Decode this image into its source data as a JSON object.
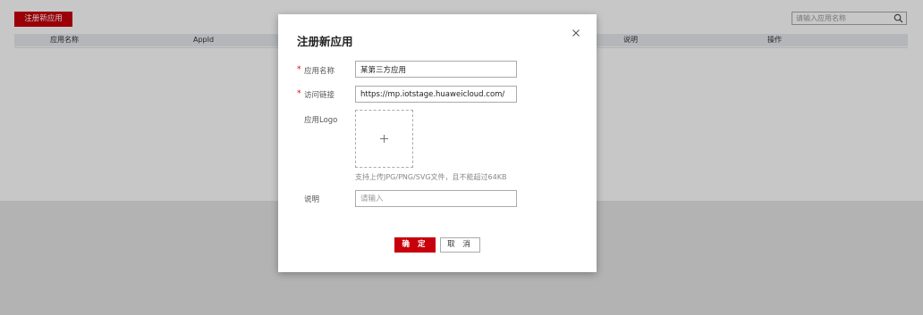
{
  "toolbar": {
    "register_label": "注册新应用"
  },
  "search": {
    "placeholder": "请输入应用名称",
    "value": ""
  },
  "table": {
    "headers": [
      "应用名称",
      "AppId",
      "说明",
      "操作"
    ]
  },
  "dialog": {
    "title": "注册新应用",
    "fields": {
      "app_name": {
        "label": "应用名称",
        "value": "某第三方应用",
        "required": true
      },
      "access_link": {
        "label": "访问链接",
        "value": "https://mp.iotstage.huaweicloud.com/",
        "required": true
      },
      "logo": {
        "label": "应用Logo",
        "hint": "支持上传JPG/PNG/SVG文件，且不能超过64KB"
      },
      "description": {
        "label": "说明",
        "placeholder": "请输入",
        "value": ""
      }
    },
    "required_mark": "*",
    "confirm_label": "确 定",
    "cancel_label": "取 消"
  },
  "colors": {
    "accent": "#c7000b",
    "overlay": "rgba(0,0,0,0.22)",
    "table_header_bg": "#e7e9ee"
  },
  "icons": {
    "close": "close-icon",
    "search": "search-icon",
    "upload": "plus-icon"
  }
}
